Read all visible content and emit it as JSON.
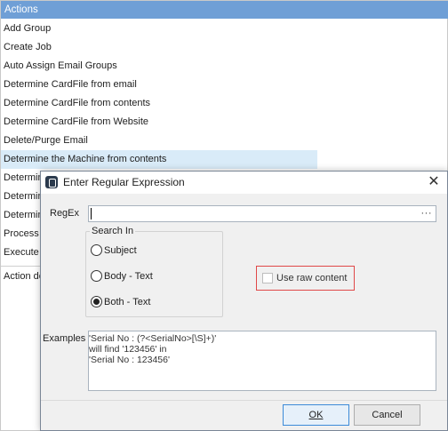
{
  "actions_panel": {
    "header": "Actions",
    "items": [
      "Add Group",
      "Create Job",
      "Auto Assign Email Groups",
      "Determine CardFile from email",
      "Determine CardFile from contents",
      "Determine CardFile from Website",
      "Delete/Purge Email",
      "Determine the Machine from contents",
      "Determin",
      "Determin",
      "Determin",
      "Process a",
      "Execute"
    ],
    "selected_index": 7,
    "detail_label": "Action de"
  },
  "dialog": {
    "title": "Enter Regular Expression",
    "regex": {
      "label": "RegEx",
      "value": "",
      "ellipsis": "···"
    },
    "search_in": {
      "title": "Search In",
      "options": [
        "Subject",
        "Body - Text",
        "Both - Text"
      ],
      "selected": "Both - Text"
    },
    "use_raw_content": {
      "label": "Use raw content",
      "checked": false
    },
    "examples": {
      "label": "Examples",
      "lines": [
        "'Serial No : (?<SerialNo>[\\S]+)'",
        "will find '123456' in",
        "'Serial No : 123456'"
      ]
    },
    "buttons": {
      "ok": "OK",
      "cancel": "Cancel"
    }
  },
  "colors": {
    "header_bg": "#6f9fd6",
    "selected_row_bg": "#d9ebf8",
    "highlight_border": "#e04848",
    "default_button_border": "#3c8ad8"
  }
}
